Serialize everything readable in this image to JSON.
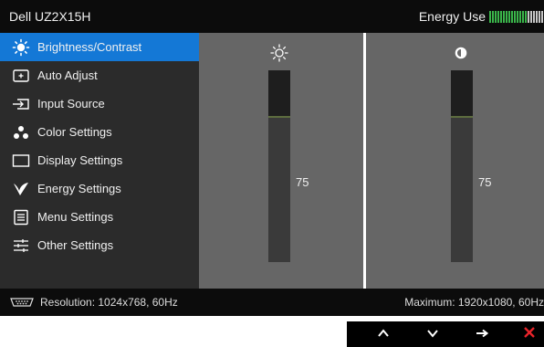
{
  "header": {
    "model": "Dell UZ2X15H",
    "energy_label": "Energy Use",
    "energy_colors": [
      "#3ab54a",
      "#3ab54a",
      "#3ab54a",
      "#3ab54a",
      "#3ab54a",
      "#3ab54a",
      "#3ab54a",
      "#3ab54a",
      "#3ab54a",
      "#3ab54a",
      "#3ab54a",
      "#3ab54a",
      "#3ab54a",
      "#3ab54a",
      "#c8c8c8",
      "#c8c8c8",
      "#c8c8c8",
      "#c8c8c8",
      "#c8c8c8",
      "#c8c8c8"
    ]
  },
  "menu": {
    "items": [
      {
        "label": "Brightness/Contrast",
        "icon": "sun-icon",
        "active": true
      },
      {
        "label": "Auto Adjust",
        "icon": "auto-adjust-icon",
        "active": false
      },
      {
        "label": "Input Source",
        "icon": "input-source-icon",
        "active": false
      },
      {
        "label": "Color Settings",
        "icon": "color-dots-icon",
        "active": false
      },
      {
        "label": "Display Settings",
        "icon": "display-icon",
        "active": false
      },
      {
        "label": "Energy Settings",
        "icon": "energy-leaf-icon",
        "active": false
      },
      {
        "label": "Menu Settings",
        "icon": "menu-list-icon",
        "active": false
      },
      {
        "label": "Other Settings",
        "icon": "sliders-icon",
        "active": false
      }
    ]
  },
  "brightness": {
    "icon": "sun-icon",
    "value": "75",
    "level_percent": 75
  },
  "contrast": {
    "icon": "contrast-icon",
    "value": "75",
    "level_percent": 75
  },
  "footer": {
    "resolution": "Resolution: 1024x768, 60Hz",
    "maximum": "Maximum: 1920x1080, 60Hz"
  },
  "nav": {
    "buttons": [
      {
        "icon": "up-arrow-icon",
        "glyph": "∧",
        "color": "#ffffff"
      },
      {
        "icon": "down-arrow-icon",
        "glyph": "∨",
        "color": "#ffffff"
      },
      {
        "icon": "right-arrow-icon",
        "glyph": "→",
        "color": "#ffffff"
      },
      {
        "icon": "close-icon",
        "glyph": "✕",
        "color": "#e8242a"
      }
    ]
  },
  "colors": {
    "accent": "#1478d6"
  }
}
